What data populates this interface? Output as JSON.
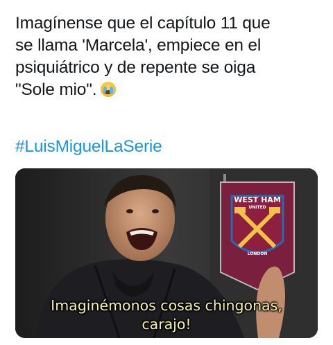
{
  "tweet": {
    "lines": [
      "Imagínense que el capítulo 11 que",
      "se llama 'Marcela', empiece en el",
      "psiquiátrico y de repente se oiga",
      "\"Sole mio\"."
    ],
    "emoji": "loudly-crying-face-icon",
    "hashtag": "#LuisMiguelLaSerie"
  },
  "media": {
    "caption_line1": "Imaginémonos cosas chingonas,",
    "caption_line2": "carajo!",
    "pennant_top": "WEST HAM",
    "pennant_sub": "UNITED",
    "pennant_bottom": "LONDON"
  },
  "colors": {
    "text": "#14171a",
    "hashtag": "#1b95e0",
    "caption": "#f7f1a8",
    "pennant": "#7a1f3d"
  }
}
